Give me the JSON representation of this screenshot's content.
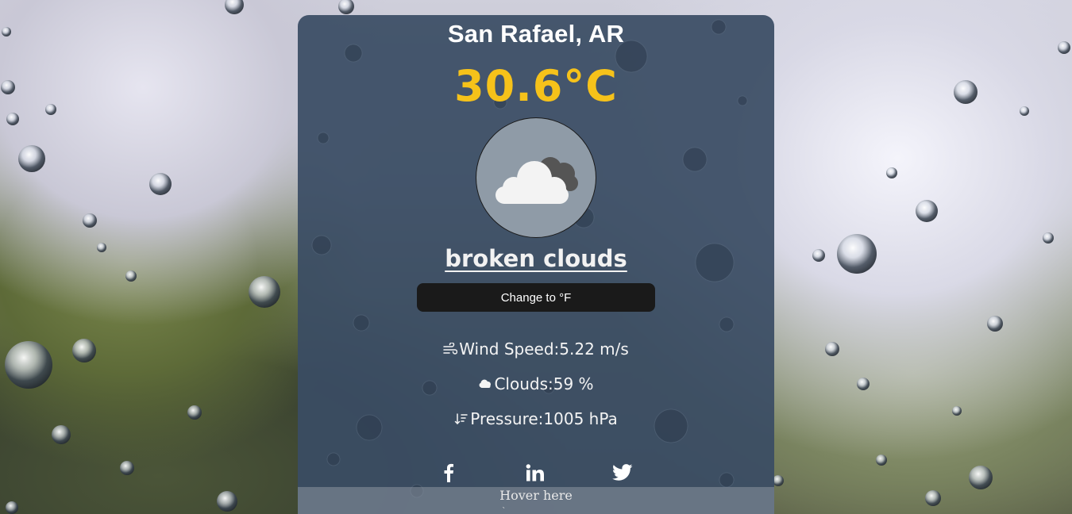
{
  "weather": {
    "city": "San Rafael, AR",
    "temperature": "30.6°C",
    "condition_icon": "broken-clouds-icon",
    "description": "broken clouds"
  },
  "controls": {
    "change_unit_label": "Change to °F"
  },
  "stats": {
    "wind_label": "Wind Speed:",
    "wind_value": "5.22 m/s",
    "clouds_label": "Clouds:",
    "clouds_value": "59 %",
    "pressure_label": "Pressure:",
    "pressure_value": "1005 hPa"
  },
  "social": {
    "icons": [
      "facebook-icon",
      "linkedin-icon",
      "twitter-icon"
    ]
  },
  "footer": {
    "hover_label": "Hover here",
    "hover_tick": "`"
  },
  "colors": {
    "card_background": "#3a4c64",
    "temperature": "#f6c21a",
    "button_background": "#1a1a1a",
    "icon_circle": "#8f9ba7"
  }
}
